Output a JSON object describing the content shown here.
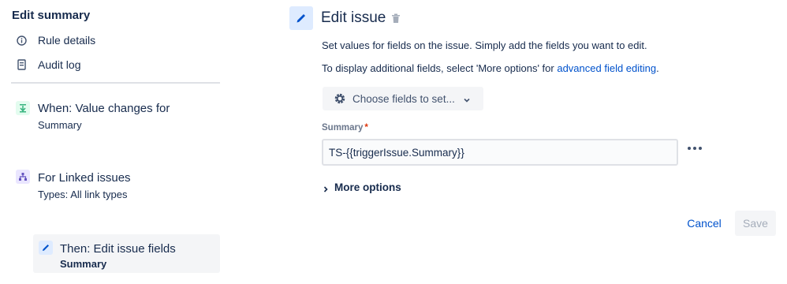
{
  "sidebar": {
    "title": "Edit summary",
    "items": [
      {
        "label": "Rule details",
        "icon": "info-icon"
      },
      {
        "label": "Audit log",
        "icon": "document-icon"
      }
    ],
    "steps": [
      {
        "title": "When: Value changes for",
        "subtitle": "Summary",
        "icon": "trigger-icon",
        "color": "#36b37e"
      },
      {
        "title": "For Linked issues",
        "subtitle": "Types: All link types",
        "icon": "branch-icon",
        "color": "#6554c0"
      },
      {
        "title": "Then: Edit issue fields",
        "subtitle": "Summary",
        "icon": "pencil-icon",
        "color": "#0052cc"
      }
    ]
  },
  "main": {
    "title": "Edit issue",
    "description1": "Set values for fields on the issue. Simply add the fields you want to edit.",
    "description2_prefix": "To display additional fields, select 'More options' for ",
    "description2_link": "advanced field editing",
    "description2_suffix": ".",
    "choose_fields_label": "Choose fields to set...",
    "field": {
      "label": "Summary",
      "required_marker": "*",
      "value": "TS-{{triggerIssue.Summary}}"
    },
    "more_options_label": "More options",
    "cancel_label": "Cancel",
    "save_label": "Save"
  },
  "colors": {
    "link": "#0052cc",
    "text": "#172b4d",
    "required": "#de350b"
  }
}
